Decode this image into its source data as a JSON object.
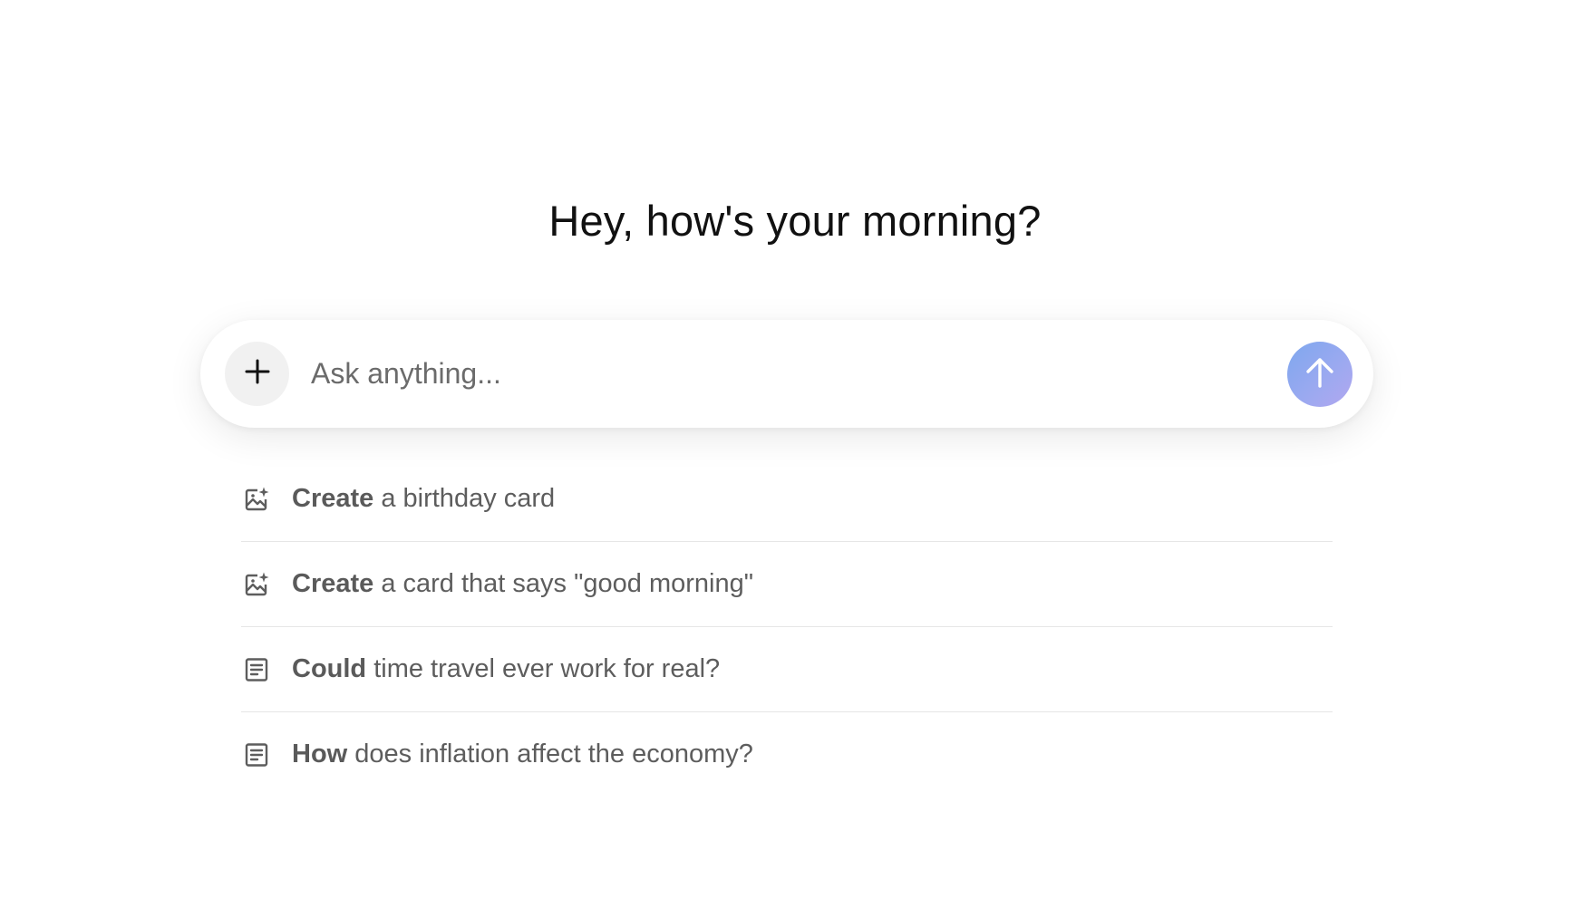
{
  "greeting": "Hey, how's your morning?",
  "composer": {
    "placeholder": "Ask anything...",
    "add_icon": "plus-icon",
    "send_icon": "arrow-up-icon",
    "send_color_start": "#7ea7ee",
    "send_color_end": "#b2a8ef"
  },
  "suggestions": [
    {
      "icon": "image-sparkle-icon",
      "verb": "Create",
      "rest": " a birthday card"
    },
    {
      "icon": "image-sparkle-icon",
      "verb": "Create",
      "rest": " a card that says \"good morning\""
    },
    {
      "icon": "document-icon",
      "verb": "Could",
      "rest": " time travel ever work for real?"
    },
    {
      "icon": "document-icon",
      "verb": "How",
      "rest": " does inflation affect the economy?"
    }
  ]
}
